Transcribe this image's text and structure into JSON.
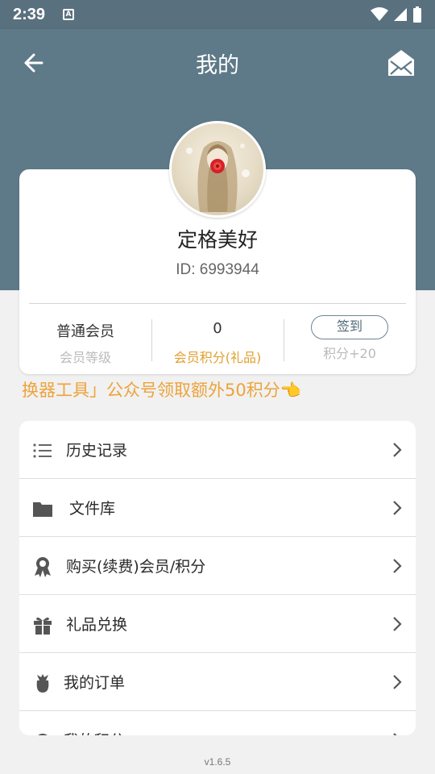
{
  "status_bar": {
    "time": "2:39",
    "notification_icon": "A"
  },
  "header": {
    "title": "我的",
    "back_icon": "arrow-left",
    "mail_icon": "envelope-open"
  },
  "profile": {
    "username": "定格美好",
    "id_text": "ID:  6993944"
  },
  "stats": [
    {
      "value": "普通会员",
      "label": "会员等级"
    },
    {
      "value": "0",
      "label": "会员积分(礼品)"
    },
    {
      "button": "签到",
      "label": "积分+20"
    }
  ],
  "banner": {
    "text": "换器工具」公众号领取额外50积分👈"
  },
  "menu": {
    "items": [
      {
        "label": "历史记录",
        "icon": "list-icon"
      },
      {
        "label": "文件库",
        "icon": "folder-icon"
      },
      {
        "label": "购买(续费)会员/积分",
        "icon": "award-icon"
      },
      {
        "label": "礼品兑换",
        "icon": "gift-icon"
      },
      {
        "label": "我的订单",
        "icon": "order-icon"
      },
      {
        "label": "我的积分",
        "icon": "points-icon"
      }
    ]
  },
  "footer": {
    "version": "v1.6.5"
  },
  "colors": {
    "primary": "#5e7a89",
    "accent_orange": "#e0a030"
  }
}
